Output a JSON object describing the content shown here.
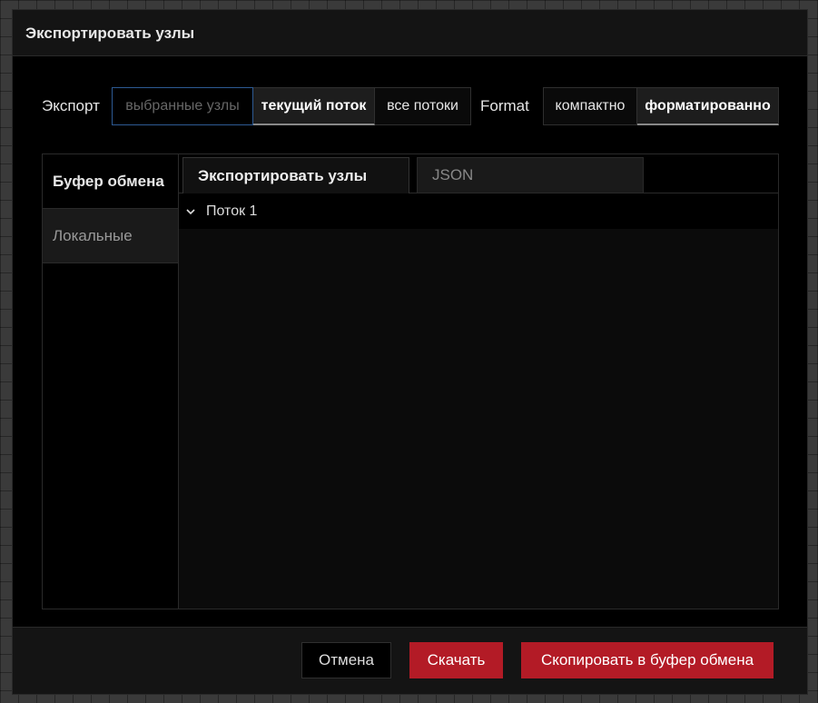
{
  "dialog": {
    "title": "Экспортировать узлы"
  },
  "export_row": {
    "label": "Экспорт",
    "options": [
      "выбранные узлы",
      "текущий поток",
      "все потоки"
    ],
    "format_label": "Format",
    "format_options": [
      "компактно",
      "форматированно"
    ]
  },
  "sidebar": {
    "items": [
      "Буфер обмена",
      "Локальные"
    ]
  },
  "tabs": [
    "Экспортировать узлы",
    "JSON"
  ],
  "tree": {
    "items": [
      "Поток 1"
    ]
  },
  "footer": {
    "cancel": "Отмена",
    "download": "Скачать",
    "copy": "Скопировать в буфер обмена"
  },
  "colors": {
    "primary": "#b31b26",
    "background": "#000000",
    "focus_border": "#2d5a93"
  }
}
